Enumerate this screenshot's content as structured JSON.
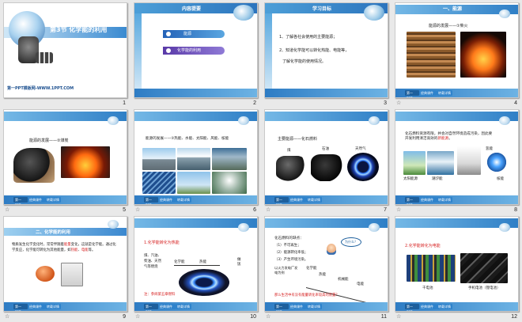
{
  "slides": [
    {
      "number": "1",
      "title": "第3节  化学能的利用",
      "footer": "第一PPT模板网-WWW.1PPT.COM"
    },
    {
      "number": "2",
      "header": "内容提要",
      "items": [
        "能源",
        "化学能的利用"
      ]
    },
    {
      "number": "3",
      "header": "学习目标",
      "lines": [
        "1、了解各社会使用的主要能源；",
        "2、知道化学能可以转化热能、电能等，",
        "了解化学能的使用情况。"
      ]
    },
    {
      "number": "4",
      "header": "一、能源",
      "caption": "能源的发展——①柴火"
    },
    {
      "number": "5",
      "caption": "能源的发展——②煤炭"
    },
    {
      "number": "6",
      "caption": "能源的发展——③热能、水能、太阳能、风能、核能"
    },
    {
      "number": "7",
      "caption": "主要能源——化石燃料",
      "labels": [
        "煤",
        "石油",
        "天然气"
      ]
    },
    {
      "number": "8",
      "text": "化石燃料资源有限，并会对自然环境造成污染，因此要开发利用清洁高效的",
      "highlight": "新能源",
      "suffix": "。",
      "labels": [
        "太阳能源",
        "潮汐能",
        "氢能",
        "核能"
      ]
    },
    {
      "number": "9",
      "header": "二、化学能的利用",
      "text_a": "物质发生化学变化时，常常伴随着",
      "hl_a": "能量",
      "text_b": "变化，这就是化学能。通过化学反应，化学能可转化为其他能量，如",
      "hl_b": "热能",
      "text_c": "、",
      "hl_c": "电能",
      "text_d": "等。"
    },
    {
      "number": "10",
      "title": "1.化学能转化为热能",
      "left_lines": [
        "煤、汽油、",
        "柴油、天然",
        "气等燃烧"
      ],
      "arrow_a": "化学能",
      "arrow_b": "热能",
      "side": "做饭",
      "note": "注：参阅第五章燃料"
    },
    {
      "number": "11",
      "title": "化石燃料的缺点：",
      "points": [
        "（1）不可再生；",
        "（2）能源转化率低；",
        "（3）产生环境污染。"
      ],
      "bubble": "为什么？",
      "flow_label": "以火力发电厂发电为例",
      "flow": [
        "化学能",
        "热能",
        "机械能",
        "电能"
      ],
      "question": "那么生活中有没有能量转化率较高的装置？"
    },
    {
      "number": "12",
      "title": "2.化学能转化为电能",
      "labels": [
        "干电池",
        "手机电池（锂电池）"
      ]
    }
  ],
  "footer_buttons": [
    "第一PPT",
    "经典课件",
    "转载详情"
  ],
  "star_glyph": "☆"
}
